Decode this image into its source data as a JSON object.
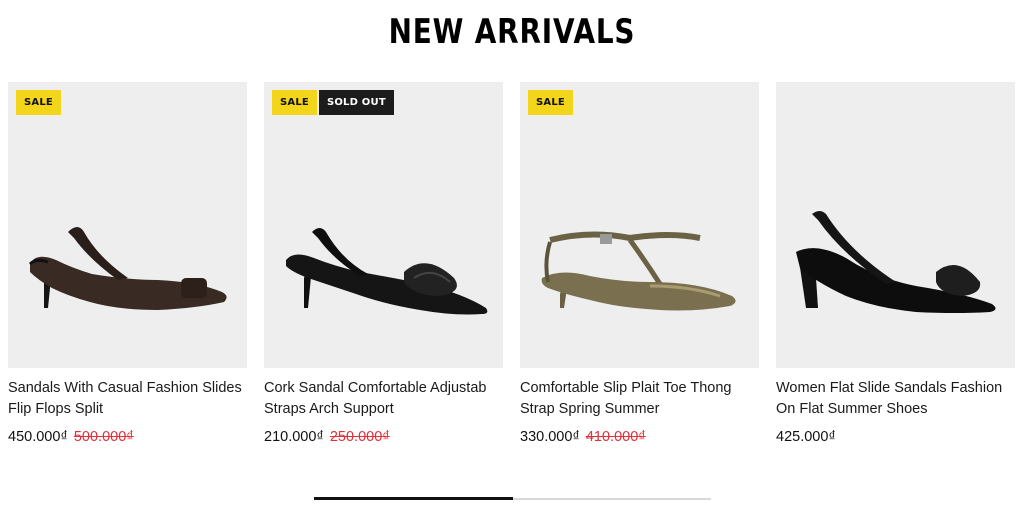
{
  "section": {
    "title": "NEW ARRIVALS"
  },
  "products": [
    {
      "name": "Sandals With Casual Fashion Slides Flip Flops Split",
      "price": "450.000₫",
      "compare_price": "500.000₫",
      "badges": [
        "SALE"
      ]
    },
    {
      "name": "Cork Sandal Comfortable Adjustab Straps Arch Support",
      "price": "210.000₫",
      "compare_price": "250.000₫",
      "badges": [
        "SALE",
        "SOLD OUT"
      ]
    },
    {
      "name": "Comfortable Slip Plait Toe Thong Strap Spring Summer",
      "price": "330.000₫",
      "compare_price": "410.000₫",
      "badges": [
        "SALE"
      ]
    },
    {
      "name": "Women Flat Slide Sandals Fashion On Flat Summer Shoes",
      "price": "425.000₫",
      "compare_price": "",
      "badges": []
    }
  ],
  "colors": {
    "sale_badge": "#f3d51b",
    "soldout_badge": "#1c1c1c",
    "compare_price": "#e0303b",
    "image_bg": "#eeeeef"
  },
  "carousel": {
    "progress": 0.5
  }
}
